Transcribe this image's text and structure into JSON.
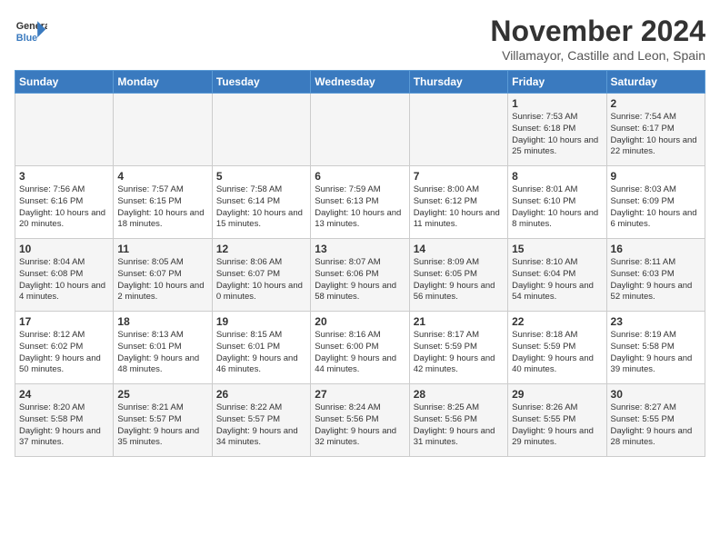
{
  "logo": {
    "line1": "General",
    "line2": "Blue"
  },
  "title": "November 2024",
  "subtitle": "Villamayor, Castille and Leon, Spain",
  "headers": [
    "Sunday",
    "Monday",
    "Tuesday",
    "Wednesday",
    "Thursday",
    "Friday",
    "Saturday"
  ],
  "weeks": [
    [
      {
        "day": "",
        "info": ""
      },
      {
        "day": "",
        "info": ""
      },
      {
        "day": "",
        "info": ""
      },
      {
        "day": "",
        "info": ""
      },
      {
        "day": "",
        "info": ""
      },
      {
        "day": "1",
        "info": "Sunrise: 7:53 AM\nSunset: 6:18 PM\nDaylight: 10 hours and 25 minutes."
      },
      {
        "day": "2",
        "info": "Sunrise: 7:54 AM\nSunset: 6:17 PM\nDaylight: 10 hours and 22 minutes."
      }
    ],
    [
      {
        "day": "3",
        "info": "Sunrise: 7:56 AM\nSunset: 6:16 PM\nDaylight: 10 hours and 20 minutes."
      },
      {
        "day": "4",
        "info": "Sunrise: 7:57 AM\nSunset: 6:15 PM\nDaylight: 10 hours and 18 minutes."
      },
      {
        "day": "5",
        "info": "Sunrise: 7:58 AM\nSunset: 6:14 PM\nDaylight: 10 hours and 15 minutes."
      },
      {
        "day": "6",
        "info": "Sunrise: 7:59 AM\nSunset: 6:13 PM\nDaylight: 10 hours and 13 minutes."
      },
      {
        "day": "7",
        "info": "Sunrise: 8:00 AM\nSunset: 6:12 PM\nDaylight: 10 hours and 11 minutes."
      },
      {
        "day": "8",
        "info": "Sunrise: 8:01 AM\nSunset: 6:10 PM\nDaylight: 10 hours and 8 minutes."
      },
      {
        "day": "9",
        "info": "Sunrise: 8:03 AM\nSunset: 6:09 PM\nDaylight: 10 hours and 6 minutes."
      }
    ],
    [
      {
        "day": "10",
        "info": "Sunrise: 8:04 AM\nSunset: 6:08 PM\nDaylight: 10 hours and 4 minutes."
      },
      {
        "day": "11",
        "info": "Sunrise: 8:05 AM\nSunset: 6:07 PM\nDaylight: 10 hours and 2 minutes."
      },
      {
        "day": "12",
        "info": "Sunrise: 8:06 AM\nSunset: 6:07 PM\nDaylight: 10 hours and 0 minutes."
      },
      {
        "day": "13",
        "info": "Sunrise: 8:07 AM\nSunset: 6:06 PM\nDaylight: 9 hours and 58 minutes."
      },
      {
        "day": "14",
        "info": "Sunrise: 8:09 AM\nSunset: 6:05 PM\nDaylight: 9 hours and 56 minutes."
      },
      {
        "day": "15",
        "info": "Sunrise: 8:10 AM\nSunset: 6:04 PM\nDaylight: 9 hours and 54 minutes."
      },
      {
        "day": "16",
        "info": "Sunrise: 8:11 AM\nSunset: 6:03 PM\nDaylight: 9 hours and 52 minutes."
      }
    ],
    [
      {
        "day": "17",
        "info": "Sunrise: 8:12 AM\nSunset: 6:02 PM\nDaylight: 9 hours and 50 minutes."
      },
      {
        "day": "18",
        "info": "Sunrise: 8:13 AM\nSunset: 6:01 PM\nDaylight: 9 hours and 48 minutes."
      },
      {
        "day": "19",
        "info": "Sunrise: 8:15 AM\nSunset: 6:01 PM\nDaylight: 9 hours and 46 minutes."
      },
      {
        "day": "20",
        "info": "Sunrise: 8:16 AM\nSunset: 6:00 PM\nDaylight: 9 hours and 44 minutes."
      },
      {
        "day": "21",
        "info": "Sunrise: 8:17 AM\nSunset: 5:59 PM\nDaylight: 9 hours and 42 minutes."
      },
      {
        "day": "22",
        "info": "Sunrise: 8:18 AM\nSunset: 5:59 PM\nDaylight: 9 hours and 40 minutes."
      },
      {
        "day": "23",
        "info": "Sunrise: 8:19 AM\nSunset: 5:58 PM\nDaylight: 9 hours and 39 minutes."
      }
    ],
    [
      {
        "day": "24",
        "info": "Sunrise: 8:20 AM\nSunset: 5:58 PM\nDaylight: 9 hours and 37 minutes."
      },
      {
        "day": "25",
        "info": "Sunrise: 8:21 AM\nSunset: 5:57 PM\nDaylight: 9 hours and 35 minutes."
      },
      {
        "day": "26",
        "info": "Sunrise: 8:22 AM\nSunset: 5:57 PM\nDaylight: 9 hours and 34 minutes."
      },
      {
        "day": "27",
        "info": "Sunrise: 8:24 AM\nSunset: 5:56 PM\nDaylight: 9 hours and 32 minutes."
      },
      {
        "day": "28",
        "info": "Sunrise: 8:25 AM\nSunset: 5:56 PM\nDaylight: 9 hours and 31 minutes."
      },
      {
        "day": "29",
        "info": "Sunrise: 8:26 AM\nSunset: 5:55 PM\nDaylight: 9 hours and 29 minutes."
      },
      {
        "day": "30",
        "info": "Sunrise: 8:27 AM\nSunset: 5:55 PM\nDaylight: 9 hours and 28 minutes."
      }
    ]
  ]
}
